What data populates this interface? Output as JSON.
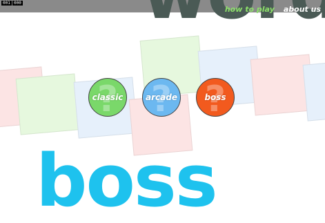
{
  "counters": [
    "001",
    "000"
  ],
  "title_top": "word",
  "title_bottom": "boss",
  "nav": {
    "how_to_play": "how to play",
    "about_us": "about us"
  },
  "modes": [
    {
      "label": "classic",
      "icon": "question-mark",
      "color": "#7ad86a"
    },
    {
      "label": "arcade",
      "icon": "question-mark",
      "color": "#6cb8f0"
    },
    {
      "label": "boss",
      "icon": "question-mark",
      "color": "#f25a1e"
    }
  ],
  "colors": {
    "title_top": "#4a5a55",
    "title_bottom": "#1ec2ee",
    "nav_how_to_play": "#8ce06a",
    "nav_about_us": "#ffffff",
    "topbar": "#8a8a8a",
    "tiles": [
      "#fce4e4",
      "#e6f8de",
      "#e6f0fb"
    ]
  }
}
